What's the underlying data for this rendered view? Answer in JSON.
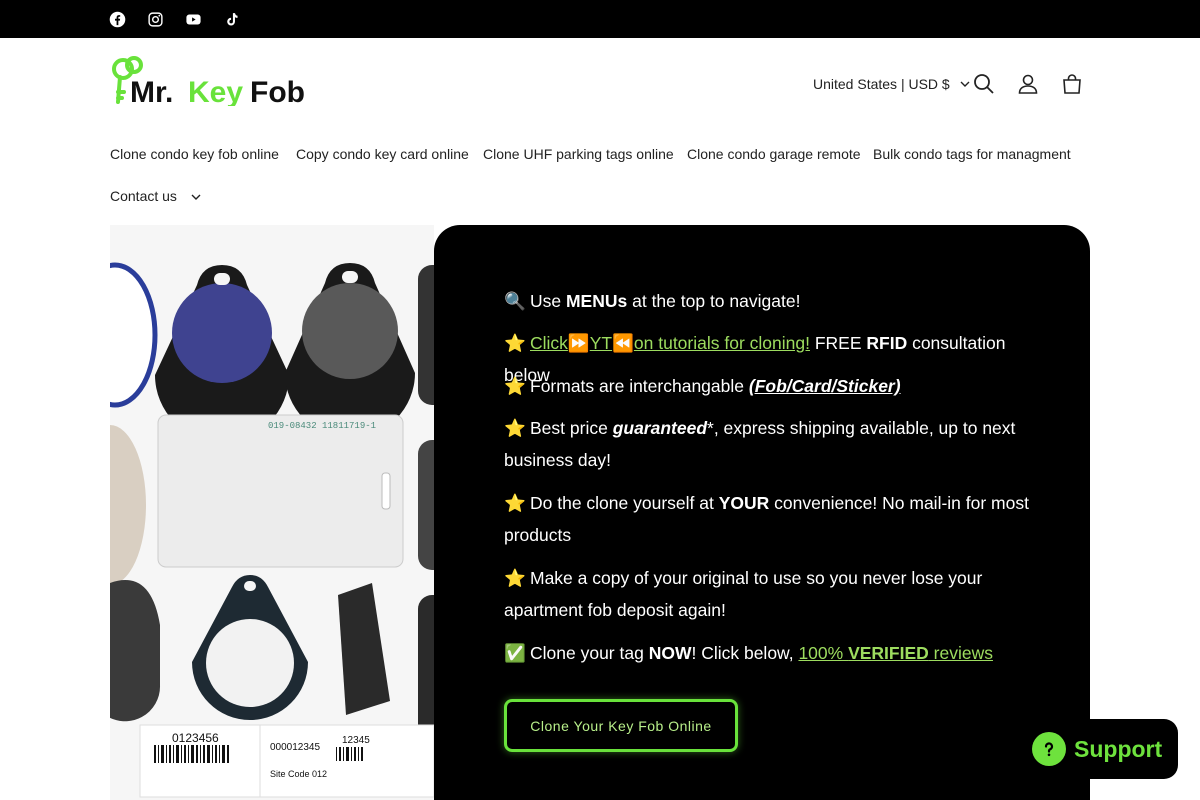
{
  "social": {
    "facebook": "facebook-icon",
    "instagram": "instagram-icon",
    "youtube": "youtube-icon",
    "tiktok": "tiktok-icon"
  },
  "brand": {
    "logo_text_prefix": "Mr.",
    "logo_text_key": "Key",
    "logo_text_suffix": "Fob",
    "accent": "#69e23b"
  },
  "header": {
    "country": "United States | USD $",
    "icons": [
      "search-icon",
      "account-icon",
      "cart-icon"
    ]
  },
  "nav": {
    "items": [
      "Clone condo key fob online",
      "Copy condo key card online",
      "Clone UHF parking tags online",
      "Clone condo garage remote",
      "Bulk condo tags for managment",
      "Contact us"
    ]
  },
  "panel": {
    "l1_emoji": "🔍",
    "l1_a": "Use ",
    "l1_b": "MENUs",
    "l1_c": " at the top to navigate!",
    "l2_emoji": "⭐",
    "l2_link1": "Click",
    "l2_ff": "⏩",
    "l2_link2": "YT",
    "l2_rw": "⏪",
    "l2_link3": "on tutorials for cloning!",
    "l2_a": " FREE ",
    "l2_b": "RFID",
    "l2_c": " consultation below",
    "l3_emoji": "⭐",
    "l3_a": "Formats are interchangable ",
    "l3_b": "(Fob/Card/Sticker)",
    "l4_emoji": "⭐",
    "l4_a": "Best price ",
    "l4_b": "guaranteed",
    "l4_c": "*, express shipping available, up to next business day!",
    "l5_emoji": "⭐",
    "l5_a": "Do the clone yourself at ",
    "l5_b": "YOUR",
    "l5_c": " convenience! No mail-in for most products",
    "l6_emoji": "⭐",
    "l6_a": "Make a copy of your original to use so you never lose your apartment fob deposit again!",
    "l7_emoji": "✅",
    "l7_a": "Clone your tag ",
    "l7_b": "NOW",
    "l7_c": "! Click below, ",
    "l7_link_a": "100% ",
    "l7_link_b": "VERIFIED",
    "l7_link_c": " reviews",
    "cta": "Clone Your Key Fob Online"
  },
  "support": {
    "label": "Support"
  },
  "hero_image": {
    "card_number": "019-08432 11811719-1",
    "barcode_number": "0123456",
    "site_code": "Site Code 012",
    "card_id": "000012345",
    "card_id_2": "12345"
  }
}
